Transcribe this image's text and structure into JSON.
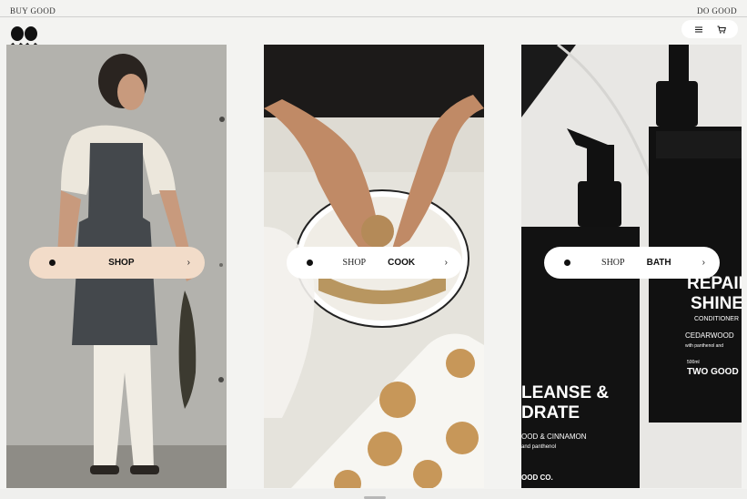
{
  "topbar": {
    "left_label": "BUY GOOD",
    "right_label": "DO GOOD"
  },
  "brand": {
    "logo_icon": "two-good-logo-icon"
  },
  "header_actions": {
    "menu_icon": "menu-icon",
    "cart_icon": "cart-icon"
  },
  "panels": [
    {
      "id": "shop",
      "image": "woman-in-apron-holding-fish",
      "cta": {
        "prefix": "",
        "label": "SHOP",
        "chevron": "›"
      },
      "accent": "#f2dcc9"
    },
    {
      "id": "cook",
      "image": "hands-shaping-food-balls",
      "cta": {
        "prefix": "SHOP",
        "label": "COOK",
        "chevron": "›"
      },
      "accent": "#ffffff"
    },
    {
      "id": "bath",
      "image": "black-pump-bottles",
      "cta": {
        "prefix": "SHOP",
        "label": "BATH",
        "chevron": "›"
      },
      "accent": "#ffffff",
      "bottle_texts": {
        "back_title_1": "REPAIR",
        "back_title_2": "SHINE",
        "back_sub": "CONDITIONER",
        "back_scent": "CEDARWOOD",
        "back_scent_2": "with panthenol and",
        "back_size": "500ml",
        "back_brand": "TWO GOOD",
        "front_title_1": "LEANSE &",
        "front_title_2": "DRATE",
        "front_scent": "OOD & CINNAMON",
        "front_scent_2": "and panthenol",
        "front_brand": "OOD CO."
      }
    }
  ]
}
